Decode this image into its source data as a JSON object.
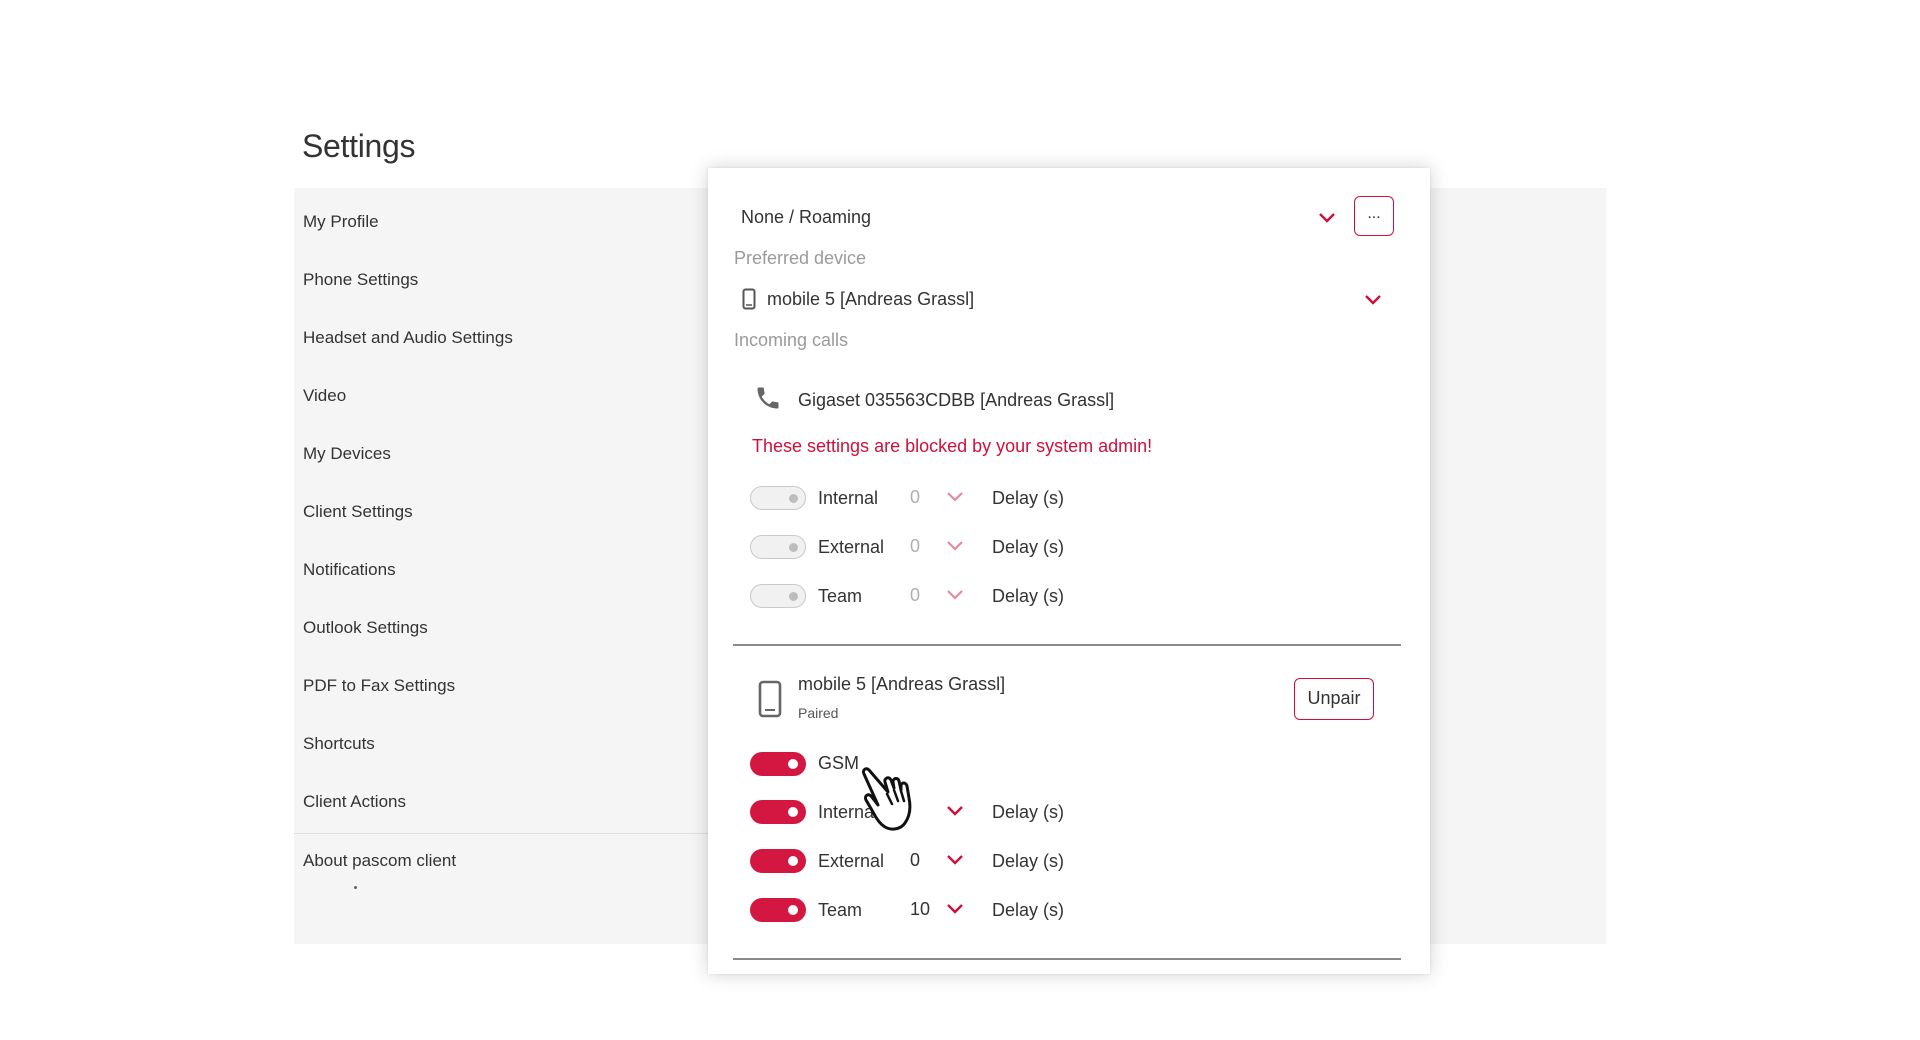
{
  "page": {
    "title": "Settings"
  },
  "sidebar": {
    "items": [
      {
        "label": "My Profile"
      },
      {
        "label": "Phone Settings"
      },
      {
        "label": "Headset and Audio Settings"
      },
      {
        "label": "Video"
      },
      {
        "label": "My Devices"
      },
      {
        "label": "Client Settings"
      },
      {
        "label": "Notifications"
      },
      {
        "label": "Outlook Settings"
      },
      {
        "label": "PDF to Fax Settings"
      },
      {
        "label": "Shortcuts"
      },
      {
        "label": "Client Actions"
      },
      {
        "label": "About pascom client"
      }
    ]
  },
  "panel": {
    "profile_select": {
      "value": "None / Roaming",
      "more_label": "..."
    },
    "preferred_device": {
      "label": "Preferred device",
      "value": "mobile 5 [Andreas Grassl]",
      "icon": "mobile-phone-icon"
    },
    "incoming_calls": {
      "label": "Incoming calls"
    },
    "desk_phone": {
      "name": "Gigaset 035563CDBB [Andreas Grassl]",
      "icon": "phone-handset-icon",
      "warning": "These settings are blocked by your system admin!",
      "rows": [
        {
          "label": "Internal",
          "delay": "0",
          "delay_label": "Delay (s)",
          "enabled": false
        },
        {
          "label": "External",
          "delay": "0",
          "delay_label": "Delay (s)",
          "enabled": false
        },
        {
          "label": "Team",
          "delay": "0",
          "delay_label": "Delay (s)",
          "enabled": false
        }
      ]
    },
    "mobile": {
      "name": "mobile 5 [Andreas Grassl]",
      "status": "Paired",
      "icon": "mobile-phone-icon",
      "unpair_label": "Unpair",
      "gsm": {
        "label": "GSM",
        "enabled": true
      },
      "rows": [
        {
          "label": "Interna",
          "delay": "",
          "delay_label": "Delay (s)",
          "enabled": true
        },
        {
          "label": "External",
          "delay": "0",
          "delay_label": "Delay (s)",
          "enabled": true
        },
        {
          "label": "Team",
          "delay": "10",
          "delay_label": "Delay (s)",
          "enabled": true
        }
      ]
    }
  },
  "colors": {
    "accent": "#d41740",
    "warning": "#d0103a",
    "sidebar_bg": "#f5f5f5"
  },
  "cursor": {
    "icon": "pointing-hand-cursor-icon"
  }
}
